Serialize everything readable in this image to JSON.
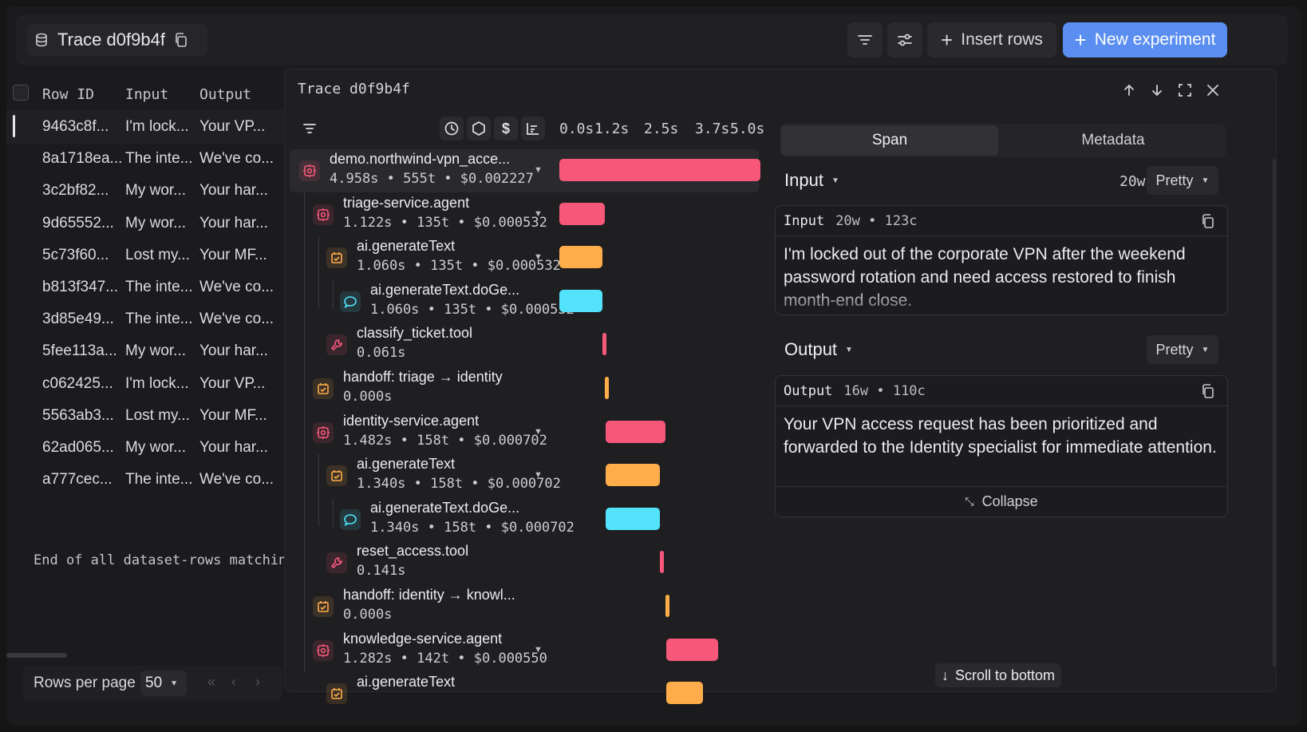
{
  "header": {
    "dataset_title": "Trace d0f9b4f",
    "insert_rows_label": "Insert rows",
    "new_experiment_label": "New experiment"
  },
  "table": {
    "columns": [
      "Row ID",
      "Input",
      "Output"
    ],
    "rows": [
      {
        "id": "9463c8f...",
        "input": "I'm lock...",
        "output": "Your VP..."
      },
      {
        "id": "8a1718ea...",
        "input": "The inte...",
        "output": "We've co..."
      },
      {
        "id": "3c2bf82...",
        "input": "My wor...",
        "output": "Your har..."
      },
      {
        "id": "9d65552...",
        "input": "My wor...",
        "output": "Your har..."
      },
      {
        "id": "5c73f60...",
        "input": "Lost my...",
        "output": "Your MF..."
      },
      {
        "id": "b813f347...",
        "input": "The inte...",
        "output": "We've co..."
      },
      {
        "id": "3d85e49...",
        "input": "The inte...",
        "output": "We've co..."
      },
      {
        "id": "5fee113a...",
        "input": "My wor...",
        "output": "Your har..."
      },
      {
        "id": "c062425...",
        "input": "I'm lock...",
        "output": "Your VP..."
      },
      {
        "id": "5563ab3...",
        "input": "Lost my...",
        "output": "Your MF..."
      },
      {
        "id": "62ad065...",
        "input": "My wor...",
        "output": "Your har..."
      },
      {
        "id": "a777cec...",
        "input": "The inte...",
        "output": "We've co..."
      }
    ],
    "end_text": "End of all dataset-rows matching",
    "rows_per_page_label": "Rows per page",
    "rows_per_page_value": "50"
  },
  "trace": {
    "title": "Trace d0f9b4f",
    "ticks": [
      "0.0s",
      "1.2s",
      "2.5s",
      "3.7s",
      "5.0s"
    ],
    "spans": [
      {
        "name": "demo.northwind-vpn_acce...",
        "meta": "4.958s • 555t • $0.002227",
        "kind": "agent",
        "start": 0.0,
        "duration": 4.958
      },
      {
        "name": "triage-service.agent",
        "meta": "1.122s • 135t • $0.000532",
        "kind": "agent",
        "start": 0.0,
        "duration": 1.122
      },
      {
        "name": "ai.generateText",
        "meta": "1.060s • 135t • $0.000532",
        "kind": "generate",
        "start": 0.0,
        "duration": 1.06
      },
      {
        "name": "ai.generateText.doGe...",
        "meta": "1.060s • 135t • $0.000532",
        "kind": "llm",
        "start": 0.0,
        "duration": 1.06
      },
      {
        "name": "classify_ticket.tool",
        "meta": "0.061s",
        "kind": "tool",
        "start": 1.06,
        "duration": 0.061
      },
      {
        "name": "handoff: triage → identity",
        "meta": "0.000s",
        "kind": "handoff",
        "start": 1.122,
        "duration": 0.0
      },
      {
        "name": "identity-service.agent",
        "meta": "1.482s • 158t • $0.000702",
        "kind": "agent",
        "start": 1.14,
        "duration": 1.482
      },
      {
        "name": "ai.generateText",
        "meta": "1.340s • 158t • $0.000702",
        "kind": "generate",
        "start": 1.14,
        "duration": 1.34
      },
      {
        "name": "ai.generateText.doGe...",
        "meta": "1.340s • 158t • $0.000702",
        "kind": "llm",
        "start": 1.14,
        "duration": 1.34
      },
      {
        "name": "reset_access.tool",
        "meta": "0.141s",
        "kind": "tool",
        "start": 2.48,
        "duration": 0.141
      },
      {
        "name": "handoff: identity → knowl...",
        "meta": "0.000s",
        "kind": "handoff",
        "start": 2.62,
        "duration": 0.0
      },
      {
        "name": "knowledge-service.agent",
        "meta": "1.282s • 142t • $0.000550",
        "kind": "agent",
        "start": 2.64,
        "duration": 1.282
      },
      {
        "name": "ai.generateText",
        "meta": "",
        "kind": "generate",
        "start": 2.64,
        "duration": 0.9
      }
    ]
  },
  "detail": {
    "tab_span": "Span",
    "tab_metadata": "Metadata",
    "input_title": "Input",
    "input_wordcount": "20w",
    "pretty_label": "Pretty",
    "input_card_label": "Input",
    "input_card_stats": "20w • 123c",
    "input_text": "I'm locked out of the corporate VPN after the weekend password rotation and need access restored to finish month-end close.",
    "output_title": "Output",
    "output_card_label": "Output",
    "output_card_stats": "16w • 110c",
    "output_text": "Your VPN access request has been prioritized and forwarded to the Identity specialist for immediate attention.",
    "collapse_label": "Collapse",
    "scroll_bottom_label": "Scroll to bottom"
  },
  "colors": {
    "agent": "#f7587a",
    "generate": "#ffad4a",
    "llm": "#52e3fb",
    "tool": "#f7587a",
    "handoff": "#ffad4a",
    "accent": "#5a8ef0"
  }
}
